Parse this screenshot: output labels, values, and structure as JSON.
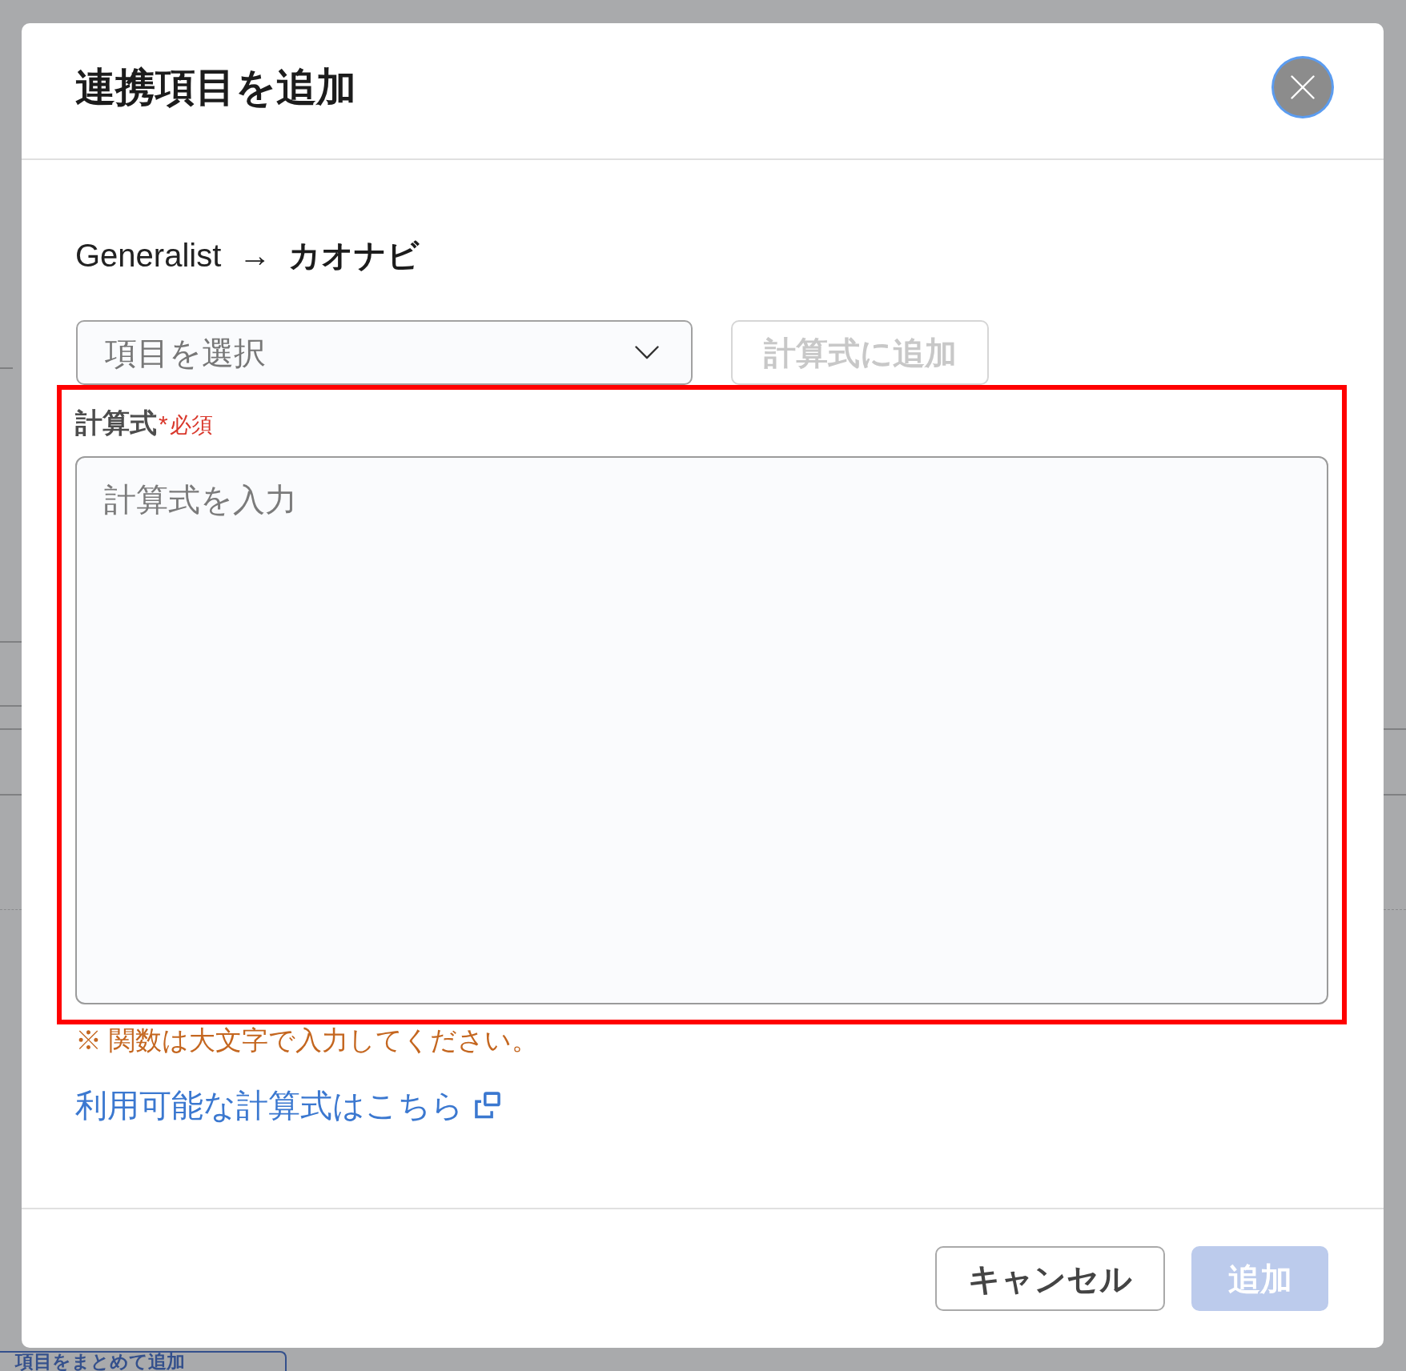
{
  "dialog": {
    "title": "連携項目を追加",
    "close_button": {
      "focused": true
    }
  },
  "mapping": {
    "source": "Generalist",
    "arrow": "→",
    "target": "カオナビ"
  },
  "item_select": {
    "placeholder": "項目を選択"
  },
  "add_to_formula_button": {
    "label": "計算式に追加",
    "disabled": true
  },
  "formula": {
    "label": "計算式",
    "required_mark": "*",
    "required_text": "必須",
    "placeholder": "計算式を入力",
    "highlighted": true
  },
  "note": "※ 関数は大文字で入力してください。",
  "help_link": {
    "label": "利用可能な計算式はこちら",
    "external": true
  },
  "footer_buttons": [
    {
      "label": "キャンセル",
      "kind": "secondary",
      "disabled": false
    },
    {
      "label": "追加",
      "kind": "primary",
      "disabled": true
    }
  ],
  "background_page": {
    "bulk_add_button": "項目をまとめて追加"
  }
}
